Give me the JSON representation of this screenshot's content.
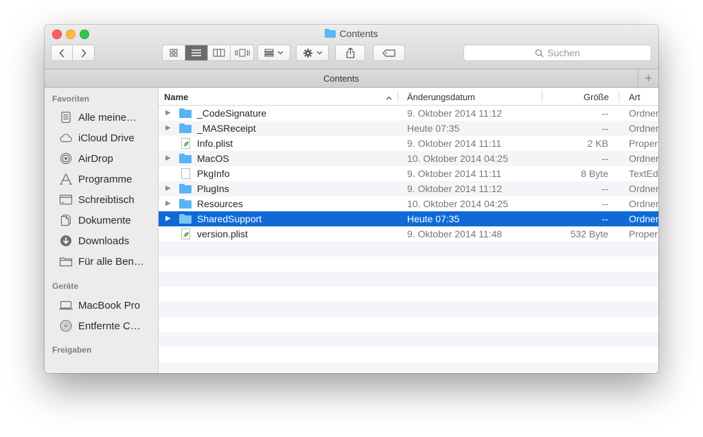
{
  "window": {
    "title": "Contents"
  },
  "toolbar": {
    "back_icon": "chevron-left-icon",
    "forward_icon": "chevron-right-icon",
    "view_modes": [
      "icon-view",
      "list-view",
      "column-view",
      "cover-flow-view"
    ],
    "active_view": "list-view",
    "search_placeholder": "Suchen"
  },
  "pathbar": {
    "title": "Contents",
    "plus_label": "+"
  },
  "sidebar": {
    "sections": [
      {
        "title": "Favoriten",
        "items": [
          {
            "label": "Alle meine…",
            "icon": "all-files-icon"
          },
          {
            "label": "iCloud Drive",
            "icon": "cloud-icon"
          },
          {
            "label": "AirDrop",
            "icon": "airdrop-icon"
          },
          {
            "label": "Programme",
            "icon": "applications-icon"
          },
          {
            "label": "Schreibtisch",
            "icon": "desktop-icon"
          },
          {
            "label": "Dokumente",
            "icon": "documents-icon"
          },
          {
            "label": "Downloads",
            "icon": "downloads-icon"
          },
          {
            "label": "Für alle Ben…",
            "icon": "folder-icon"
          }
        ]
      },
      {
        "title": "Geräte",
        "items": [
          {
            "label": "MacBook Pro",
            "icon": "laptop-icon"
          },
          {
            "label": "Entfernte C…",
            "icon": "disc-icon"
          }
        ]
      },
      {
        "title": "Freigaben",
        "items": []
      }
    ]
  },
  "columns": {
    "name": "Name",
    "date": "Änderungsdatum",
    "size": "Größe",
    "kind": "Art",
    "sort_indicator": "^"
  },
  "files": [
    {
      "name": "_CodeSignature",
      "date": "9. Oktober 2014 11:12",
      "size": "--",
      "kind": "Ordner",
      "type": "folder",
      "expandable": true,
      "selected": false
    },
    {
      "name": "_MASReceipt",
      "date": "Heute 07:35",
      "size": "--",
      "kind": "Ordner",
      "type": "folder",
      "expandable": true,
      "selected": false
    },
    {
      "name": "Info.plist",
      "date": "9. Oktober 2014 11:11",
      "size": "2 KB",
      "kind": "Proper",
      "type": "plist",
      "expandable": false,
      "selected": false
    },
    {
      "name": "MacOS",
      "date": "10. Oktober 2014 04:25",
      "size": "--",
      "kind": "Ordner",
      "type": "folder",
      "expandable": true,
      "selected": false
    },
    {
      "name": "PkgInfo",
      "date": "9. Oktober 2014 11:11",
      "size": "8 Byte",
      "kind": "TextEd",
      "type": "doc",
      "expandable": false,
      "selected": false
    },
    {
      "name": "PlugIns",
      "date": "9. Oktober 2014 11:12",
      "size": "--",
      "kind": "Ordner",
      "type": "folder",
      "expandable": true,
      "selected": false
    },
    {
      "name": "Resources",
      "date": "10. Oktober 2014 04:25",
      "size": "--",
      "kind": "Ordner",
      "type": "folder",
      "expandable": true,
      "selected": false
    },
    {
      "name": "SharedSupport",
      "date": "Heute 07:35",
      "size": "--",
      "kind": "Ordner",
      "type": "folder",
      "expandable": true,
      "selected": true
    },
    {
      "name": "version.plist",
      "date": "9. Oktober 2014 11:48",
      "size": "532 Byte",
      "kind": "Proper",
      "type": "plist",
      "expandable": false,
      "selected": false
    }
  ],
  "empty_rows": 9,
  "colors": {
    "selection": "#0f6ad8",
    "folder": "#58b4f2",
    "stripe": "#f3f5f8"
  }
}
